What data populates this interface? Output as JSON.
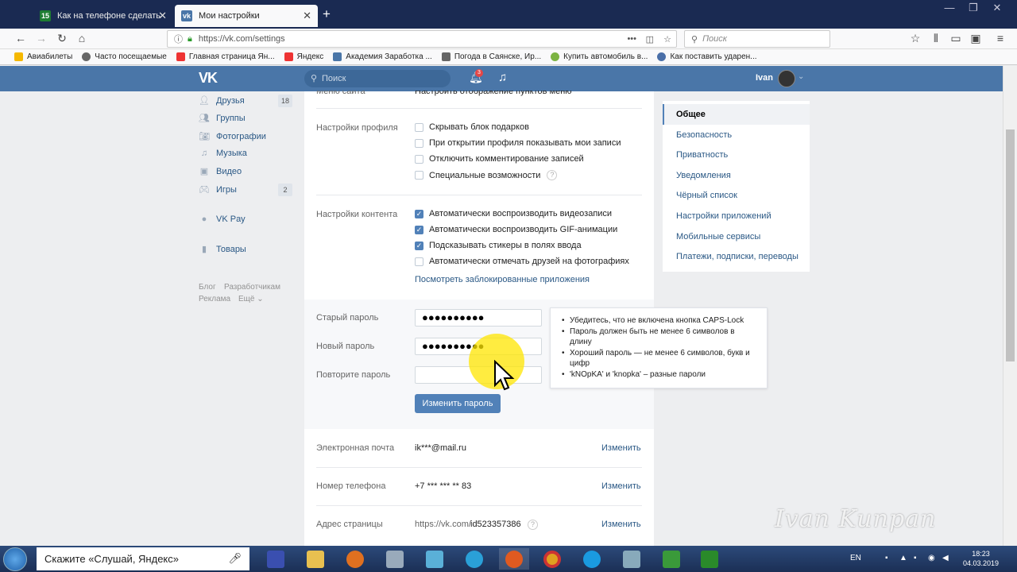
{
  "browser": {
    "tabs": [
      {
        "title": "Как на телефоне сделать скр…"
      },
      {
        "title": "Мои настройки"
      }
    ],
    "url": "https://vk.com/settings",
    "search_placeholder": "Поиск",
    "bookmarks": [
      {
        "label": "Авиабилеты"
      },
      {
        "label": "Часто посещаемые"
      },
      {
        "label": "Главная страница Ян..."
      },
      {
        "label": "Яндекс"
      },
      {
        "label": "Академия Заработка ..."
      },
      {
        "label": "Погода в Саянске, Ир..."
      },
      {
        "label": "Купить автомобиль в..."
      },
      {
        "label": "Как поставить ударен..."
      }
    ]
  },
  "vk_header": {
    "logo": "VK",
    "search_placeholder": "Поиск",
    "notification_count": "3",
    "username": "Ivan"
  },
  "left_menu": {
    "items": [
      {
        "label": "Друзья",
        "badge": "18"
      },
      {
        "label": "Группы"
      },
      {
        "label": "Фотографии"
      },
      {
        "label": "Музыка"
      },
      {
        "label": "Видео"
      },
      {
        "label": "Игры",
        "badge": "2"
      },
      {
        "label": "VK Pay"
      },
      {
        "label": "Товары"
      }
    ],
    "footer": {
      "blog": "Блог",
      "dev": "Разработчикам",
      "ads": "Реклама",
      "more": "Ещё ⌄"
    }
  },
  "settings": {
    "top_label": "Меню сайта",
    "top_value": "Настроить отображение пунктов меню",
    "profile": {
      "label": "Настройки профиля",
      "options": [
        {
          "text": "Скрывать блок подарков",
          "checked": false
        },
        {
          "text": "При открытии профиля показывать мои записи",
          "checked": false
        },
        {
          "text": "Отключить комментирование записей",
          "checked": false
        },
        {
          "text": "Специальные возможности",
          "checked": false
        }
      ]
    },
    "content": {
      "label": "Настройки контента",
      "options": [
        {
          "text": "Автоматически воспроизводить видеозаписи",
          "checked": true
        },
        {
          "text": "Автоматически воспроизводить GIF-анимации",
          "checked": true
        },
        {
          "text": "Подсказывать стикеры в полях ввода",
          "checked": true
        },
        {
          "text": "Автоматически отмечать друзей на фотографиях",
          "checked": false
        }
      ],
      "blocked_apps_link": "Посмотреть заблокированные приложения"
    },
    "password": {
      "old_label": "Старый пароль",
      "old_value": "●●●●●●●●●●",
      "new_label": "Новый пароль",
      "new_value": "●●●●●●●●●●",
      "repeat_label": "Повторите пароль",
      "repeat_value": "",
      "button": "Изменить пароль",
      "tips": [
        "Убедитесь, что не включена кнопка CAPS-Lock",
        "Пароль должен быть не менее 6 символов в длину",
        "Хороший пароль — не менее 6 символов, букв и цифр",
        "'kNOpKA' и 'knopka' – разные пароли"
      ]
    },
    "email": {
      "label": "Электронная почта",
      "value": "ik***@mail.ru",
      "action": "Изменить"
    },
    "phone": {
      "label": "Номер телефона",
      "value": "+7 *** *** ** 83",
      "action": "Изменить"
    },
    "address": {
      "label": "Адрес страницы",
      "value_prefix": "https://vk.com/",
      "value_id": "id523357386",
      "action": "Изменить"
    }
  },
  "right_menu": {
    "items": [
      {
        "label": "Общее",
        "selected": true
      },
      {
        "label": "Безопасность"
      },
      {
        "label": "Приватность"
      },
      {
        "label": "Уведомления"
      },
      {
        "label": "Чёрный список"
      },
      {
        "label": "Настройки приложений"
      },
      {
        "label": "Мобильные сервисы"
      },
      {
        "label": "Платежи, подписки, переводы"
      }
    ]
  },
  "watermark": "Ivan Kunpan",
  "taskbar": {
    "search_text": "Скажите «Слушай, Яндекс»",
    "lang": "EN",
    "time": "18:23",
    "date": "04.03.2019"
  }
}
